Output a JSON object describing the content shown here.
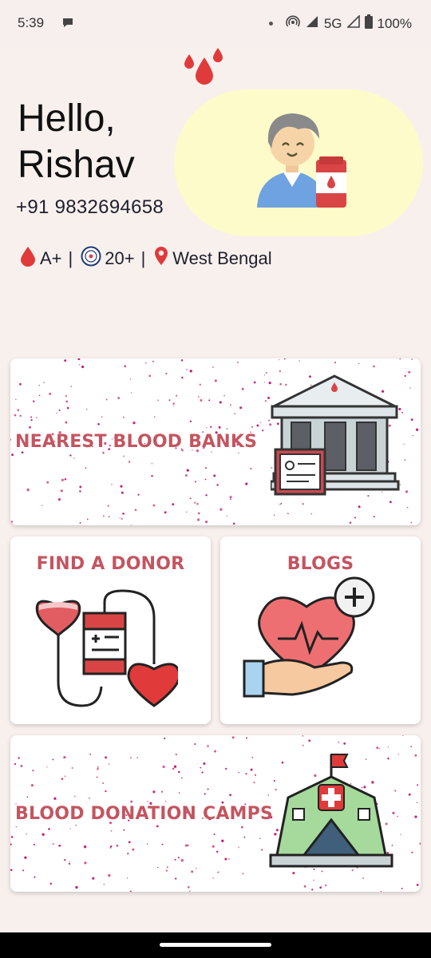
{
  "status_bar": {
    "time": "5:39",
    "network": "5G",
    "battery": "100%",
    "icons": [
      "chat-icon",
      "hotspot-icon",
      "signal-icon",
      "battery-icon"
    ]
  },
  "profile": {
    "greeting": "Hello,",
    "name": "Rishav",
    "phone": "+91 9832694658",
    "blood_group": "A+",
    "donations": "20+",
    "location": "West Bengal",
    "separator": "|"
  },
  "cards": {
    "blood_banks": "NEAREST BLOOD BANKS",
    "find_donor": "FIND A DONOR",
    "blogs": "BLOGS",
    "camps": "BLOOD DONATION CAMPS"
  },
  "colors": {
    "background": "#f8f0ed",
    "accent": "#c45560",
    "blob": "#fdfbc9",
    "drop_red": "#e03a3a"
  }
}
